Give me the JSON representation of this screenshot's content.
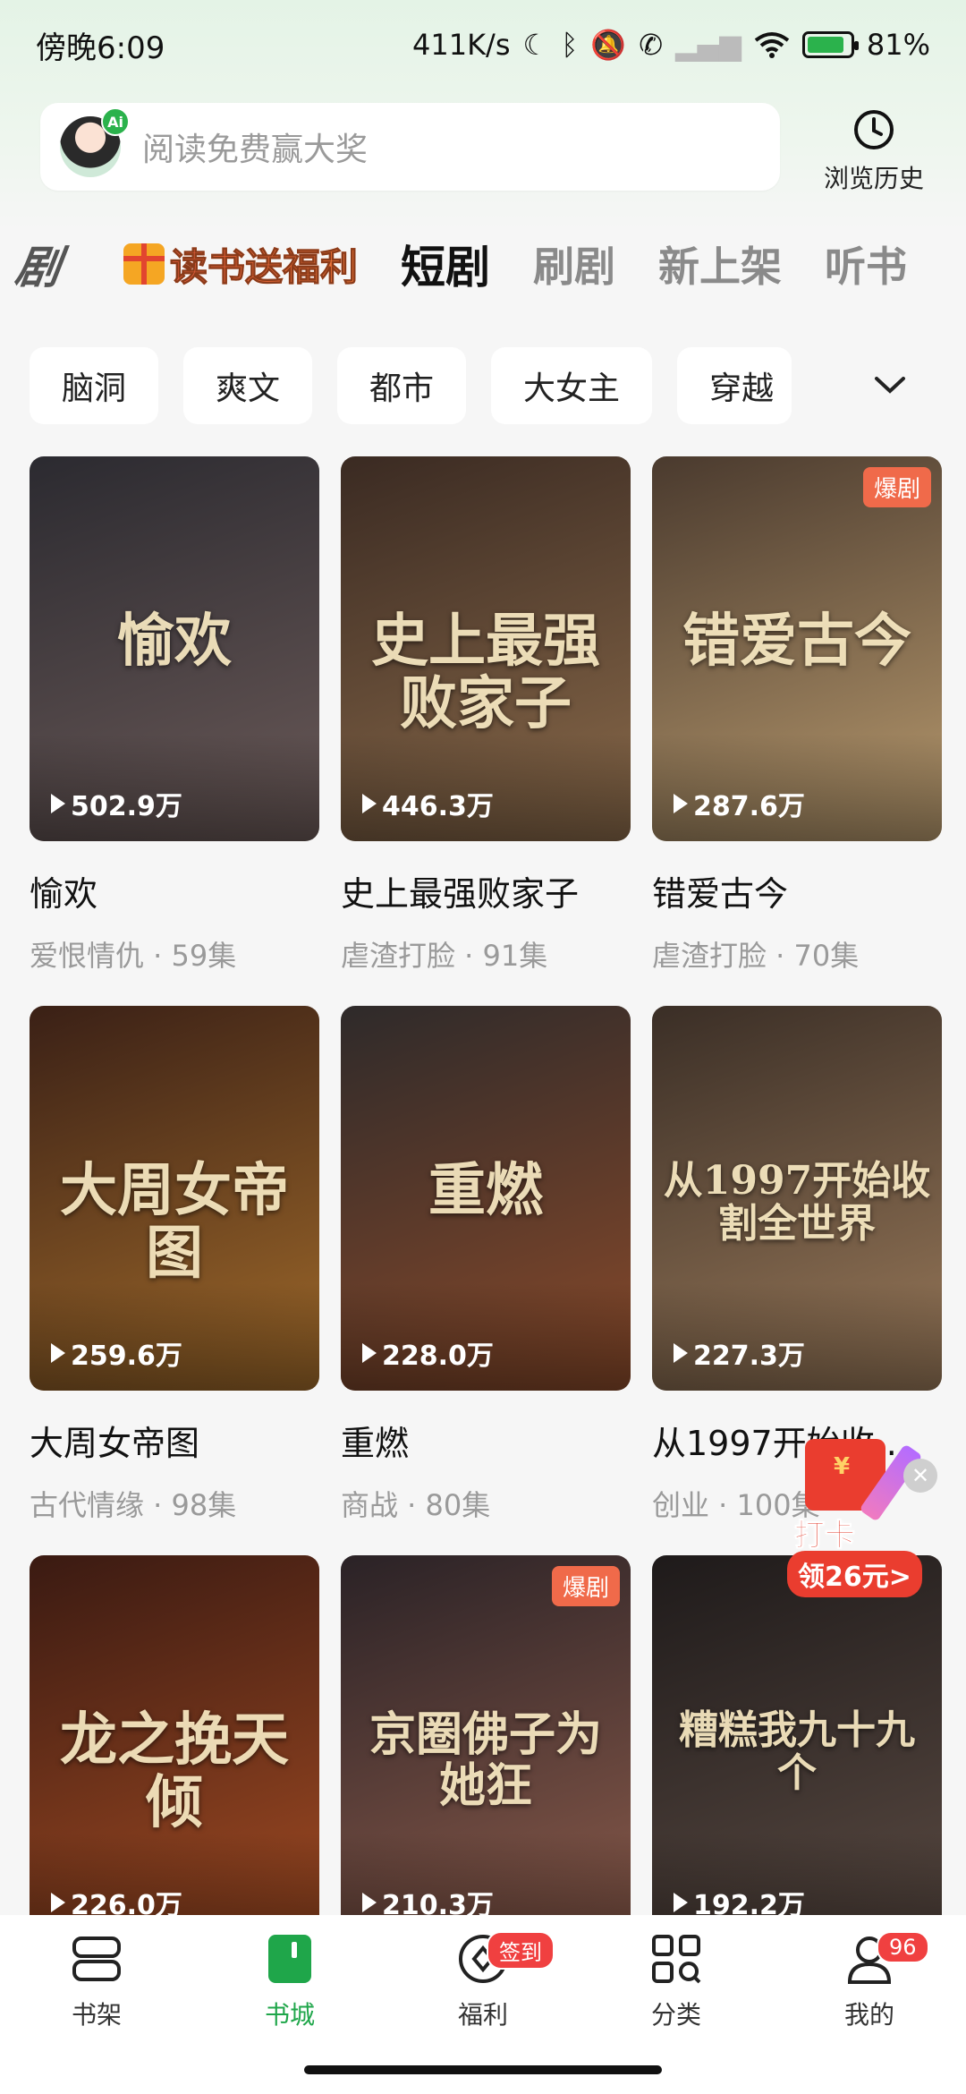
{
  "status_bar": {
    "time": "傍晚6:09",
    "network_speed": "411K/s",
    "battery": "81%",
    "icons": [
      "moon-icon",
      "bluetooth-icon",
      "mute-icon",
      "call-icon",
      "signal-icon",
      "wifi-icon",
      "battery-icon"
    ]
  },
  "search": {
    "placeholder": "阅读免费赢大奖",
    "ai_badge": "Ai"
  },
  "history": {
    "label": "浏览历史"
  },
  "tabs": {
    "logo": "剧",
    "promo": "读书送福利",
    "items": [
      {
        "label": "短剧",
        "active": true
      },
      {
        "label": "刷剧",
        "active": false
      },
      {
        "label": "新上架",
        "active": false
      },
      {
        "label": "听书",
        "active": false
      }
    ]
  },
  "chips": [
    "脑洞",
    "爽文",
    "都市",
    "大女主",
    "穿越"
  ],
  "cards": [
    {
      "title": "愉欢",
      "cover_text": "愉欢",
      "plays": "502.9万",
      "meta": "爱恨情仇 · 59集",
      "hot": "",
      "colors": [
        "#2b2a30",
        "#6b5a58"
      ]
    },
    {
      "title": "史上最强败家子",
      "cover_text": "史上最强败家子",
      "plays": "446.3万",
      "meta": "虐渣打脸 · 91集",
      "hot": "",
      "colors": [
        "#3a2a22",
        "#8a6a4a"
      ]
    },
    {
      "title": "错爱古今",
      "cover_text": "错爱古今",
      "plays": "287.6万",
      "meta": "虐渣打脸 · 70集",
      "hot": "爆剧",
      "colors": [
        "#4a3a2e",
        "#b89a6e"
      ]
    },
    {
      "title": "大周女帝图",
      "cover_text": "大周女帝图",
      "plays": "259.6万",
      "meta": "古代情缘 · 98集",
      "hot": "",
      "colors": [
        "#3a2016",
        "#a06a2a"
      ]
    },
    {
      "title": "重燃",
      "cover_text": "重燃",
      "plays": "228.0万",
      "meta": "商战 · 80集",
      "hot": "",
      "colors": [
        "#2e2a2a",
        "#8a4a2a"
      ]
    },
    {
      "title": "从1997开始收…",
      "cover_text": "从1997开始收割全世界",
      "plays": "227.3万",
      "meta": "创业 · 100集",
      "hot": "",
      "colors": [
        "#3a2e26",
        "#9a7a5a"
      ]
    },
    {
      "title": "",
      "cover_text": "龙之挽天倾",
      "plays": "226.0万",
      "meta": "",
      "hot": "",
      "colors": [
        "#3a1a12",
        "#a04a22"
      ]
    },
    {
      "title": "",
      "cover_text": "京圈佛子为她狂",
      "plays": "210.3万",
      "meta": "",
      "hot": "爆剧",
      "colors": [
        "#2a2226",
        "#8a5a4a"
      ]
    },
    {
      "title": "",
      "cover_text": "糟糕我九十九个",
      "plays": "192.2万",
      "meta": "",
      "hot": "",
      "colors": [
        "#1e1a1a",
        "#5a4a42"
      ]
    }
  ],
  "float_promo": {
    "line1": "打卡",
    "line2": "领26元>"
  },
  "bottom_nav": [
    {
      "label": "书架",
      "icon": "bookshelf-icon",
      "badge": ""
    },
    {
      "label": "书城",
      "icon": "bookstore-icon",
      "badge": ""
    },
    {
      "label": "福利",
      "icon": "welfare-icon",
      "badge": "签到"
    },
    {
      "label": "分类",
      "icon": "category-icon",
      "badge": ""
    },
    {
      "label": "我的",
      "icon": "profile-icon",
      "badge": "96"
    }
  ],
  "colors": {
    "accent": "#1fa64a",
    "hot_badge": "#f06a4a",
    "nav_badge": "#f04040"
  }
}
